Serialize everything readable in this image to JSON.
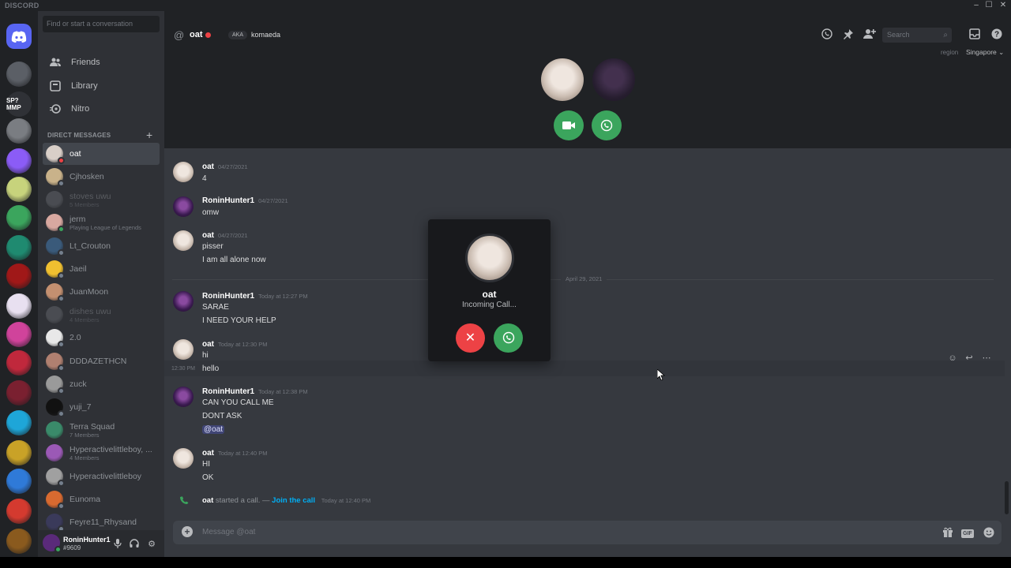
{
  "window": {
    "app_name": "DISCORD",
    "min": "–",
    "max": "☐",
    "close": "✕"
  },
  "servers": [
    {
      "icon": "discord-home-icon",
      "color": "#5865f2"
    },
    {
      "color": "#5b5f66"
    },
    {
      "label": "SP?MMP",
      "color": "#2f3136"
    },
    {
      "color": "#7a7d82"
    },
    {
      "color": "#8b5cf6"
    },
    {
      "color": "#c7d37c"
    },
    {
      "color": "#3ba55d"
    },
    {
      "color": "#1f8a70"
    },
    {
      "color": "#a01818"
    },
    {
      "color": "#e8e0f0"
    },
    {
      "color": "#d0439b"
    },
    {
      "color": "#c0283c"
    },
    {
      "color": "#7a2030"
    },
    {
      "color": "#1ea6d8"
    },
    {
      "color": "#c9a227"
    },
    {
      "color": "#2f7ad8"
    },
    {
      "color": "#d43a2f"
    },
    {
      "color": "#8a5a1e"
    }
  ],
  "dm_panel": {
    "search_placeholder": "Find or start a conversation",
    "nav": [
      {
        "label": "Friends",
        "icon": "friends-icon"
      },
      {
        "label": "Library",
        "icon": "library-icon"
      },
      {
        "label": "Nitro",
        "icon": "nitro-icon"
      }
    ],
    "section_header": "DIRECT MESSAGES",
    "items": [
      {
        "name": "oat",
        "status": "dnd",
        "color": "#d9cfc8",
        "active": true
      },
      {
        "name": "Cjhosken",
        "status": "off",
        "color": "#c9b28a"
      },
      {
        "name": "stoves uwu",
        "sub": "5 Members",
        "color": "#6b6e74",
        "faded": true
      },
      {
        "name": "jerm",
        "sub": "Playing League of Legends",
        "status": "on",
        "color": "#d8a8a0"
      },
      {
        "name": "Lt_Crouton",
        "status": "off",
        "color": "#3a5a7a"
      },
      {
        "name": "Jaeil",
        "status": "off",
        "color": "#f0c030"
      },
      {
        "name": "JuanMoon",
        "status": "off",
        "color": "#c49070"
      },
      {
        "name": "dishes uwu",
        "sub": "4 Members",
        "color": "#6b6e74",
        "faded": true
      },
      {
        "name": "2.0",
        "status": "off",
        "color": "#e8e8e8"
      },
      {
        "name": "DDDAZETHCN",
        "status": "off",
        "color": "#b08070"
      },
      {
        "name": "zuck",
        "status": "off",
        "color": "#9a9a9a"
      },
      {
        "name": "yuji_7",
        "status": "off",
        "color": "#111111"
      },
      {
        "name": "Terra Squad",
        "sub": "7 Members",
        "color": "#3a8a6a"
      },
      {
        "name": "Hyperactivelittleboy, ...",
        "sub": "4 Members",
        "color": "#9b59b6"
      },
      {
        "name": "Hyperactivelittleboy",
        "status": "off",
        "color": "#a0a0a0"
      },
      {
        "name": "Eunoma",
        "status": "off",
        "color": "#d86a30"
      },
      {
        "name": "Feyre11_Rhysand",
        "status": "off",
        "color": "#3a3a5a"
      }
    ]
  },
  "user_panel": {
    "name": "RoninHunter1",
    "tag": "#9609"
  },
  "header": {
    "at_symbol": "@",
    "name": "oat",
    "aka": "AKA",
    "nickname": "komaeda",
    "search_placeholder": "Search",
    "region_label": "region",
    "region_value": "Singapore ⌄"
  },
  "messages": [
    {
      "author": "oat",
      "time": "04/27/2021",
      "lines": [
        "4"
      ],
      "avatar": "oat"
    },
    {
      "author": "RoninHunter1",
      "time": "04/27/2021",
      "lines": [
        "omw"
      ],
      "avatar": "ronin"
    },
    {
      "author": "oat",
      "time": "04/27/2021",
      "lines": [
        "pisser",
        "I am all alone now"
      ],
      "avatar": "oat"
    },
    {
      "author": "RoninHunter1",
      "time": "Today at 12:27 PM",
      "lines": [
        "SARAE",
        "I NEED YOUR HELP"
      ],
      "avatar": "ronin"
    },
    {
      "author": "oat",
      "time": "Today at 12:30 PM",
      "lines": [
        "hi",
        "hello"
      ],
      "avatar": "oat"
    },
    {
      "author": "RoninHunter1",
      "time": "Today at 12:38 PM",
      "lines": [
        "CAN YOU CALL ME",
        "DONT ASK",
        "@oat"
      ],
      "avatar": "ronin"
    },
    {
      "author": "oat",
      "time": "Today at 12:40 PM",
      "lines": [
        "HI",
        "OK"
      ],
      "avatar": "oat"
    }
  ],
  "divider_label": "April 29, 2021",
  "hover_time": "12:30 PM",
  "system_message": {
    "author": "oat",
    "text": "started a call. —",
    "link": "Join the call",
    "time": "Today at 12:40 PM"
  },
  "composer": {
    "placeholder": "Message @oat",
    "gif": "GIF"
  },
  "popup": {
    "name": "oat",
    "status": "Incoming Call..."
  },
  "colors": {
    "accent": "#5865f2",
    "green": "#3ba55d",
    "red": "#ed4245",
    "link": "#00aff4"
  }
}
